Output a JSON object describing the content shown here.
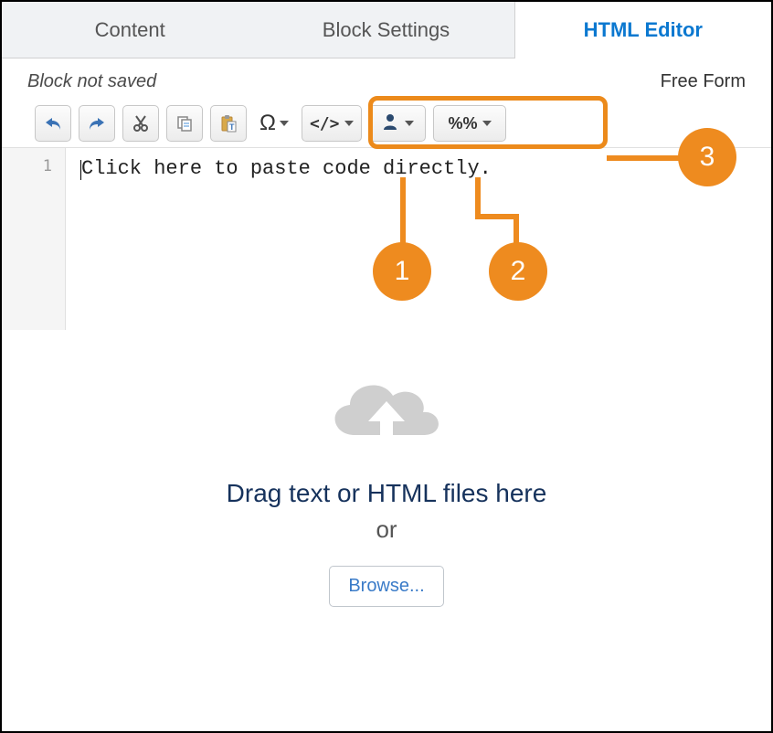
{
  "tabs": {
    "content": "Content",
    "blockSettings": "Block Settings",
    "htmlEditor": "HTML Editor"
  },
  "status": {
    "left": "Block not saved",
    "right": "Free Form"
  },
  "toolbar": {
    "omega": "Ω",
    "code": "</>",
    "percent": "%%"
  },
  "editor": {
    "lineNumber": "1",
    "placeholder": "Click here to paste code directly."
  },
  "dropzone": {
    "title": "Drag text or HTML files here",
    "or": "or",
    "browse": "Browse..."
  },
  "callouts": {
    "c1": "1",
    "c2": "2",
    "c3": "3"
  }
}
